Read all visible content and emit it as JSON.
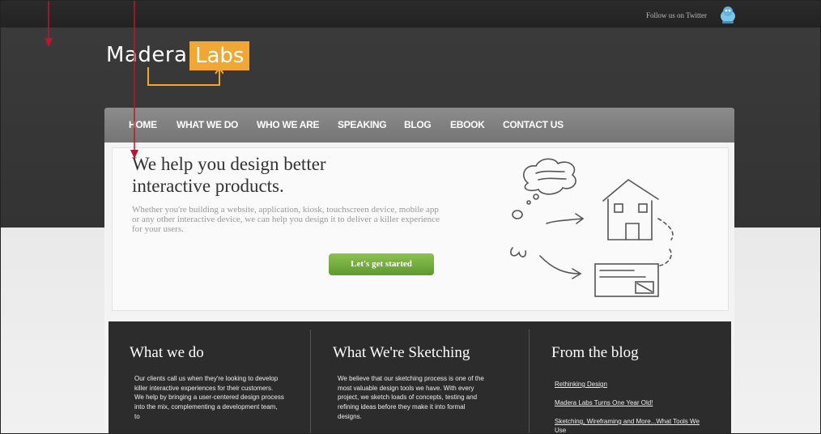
{
  "header": {
    "twitter_text": "Follow us on Twitter",
    "bird_icon": "twitter-bird-icon"
  },
  "logo": {
    "part1": "Madera",
    "part2": "Labs",
    "accent": "#f0a733"
  },
  "nav": {
    "items": [
      "HOME",
      "WHAT WE DO",
      "WHO WE ARE",
      "SPEAKING",
      "BLOG",
      "EBOOK",
      "CONTACT US"
    ]
  },
  "hero": {
    "title": "We help you design better interactive products.",
    "text": "Whether you're building a website, application, kiosk, touchscreen device, mobile app or any other interactive device, we can help you design it to deliver a killer experience for your users.",
    "cta": "Let's get started",
    "cta_color": "#6fa83a"
  },
  "columns": {
    "what_we_do": {
      "title": "What we do",
      "text": "Our clients call us when they're looking to develop killer interactive experiences for their customers. We help by bringing a user-centered design process into the mix, complementing a development team, to"
    },
    "sketching": {
      "title": "What We're Sketching",
      "text": "We believe that our sketching process is one of the most valuable design tools we have. With every project, we sketch loads of concepts, testing and refining ideas before they make it into formal designs."
    },
    "blog": {
      "title": "From the blog",
      "links": [
        "Rethinking Design",
        "Madera Labs Turns One Year Old!",
        "Sketching, Wireframing and More...What Tools We Use"
      ]
    }
  },
  "annotation_color": "#c8102e"
}
